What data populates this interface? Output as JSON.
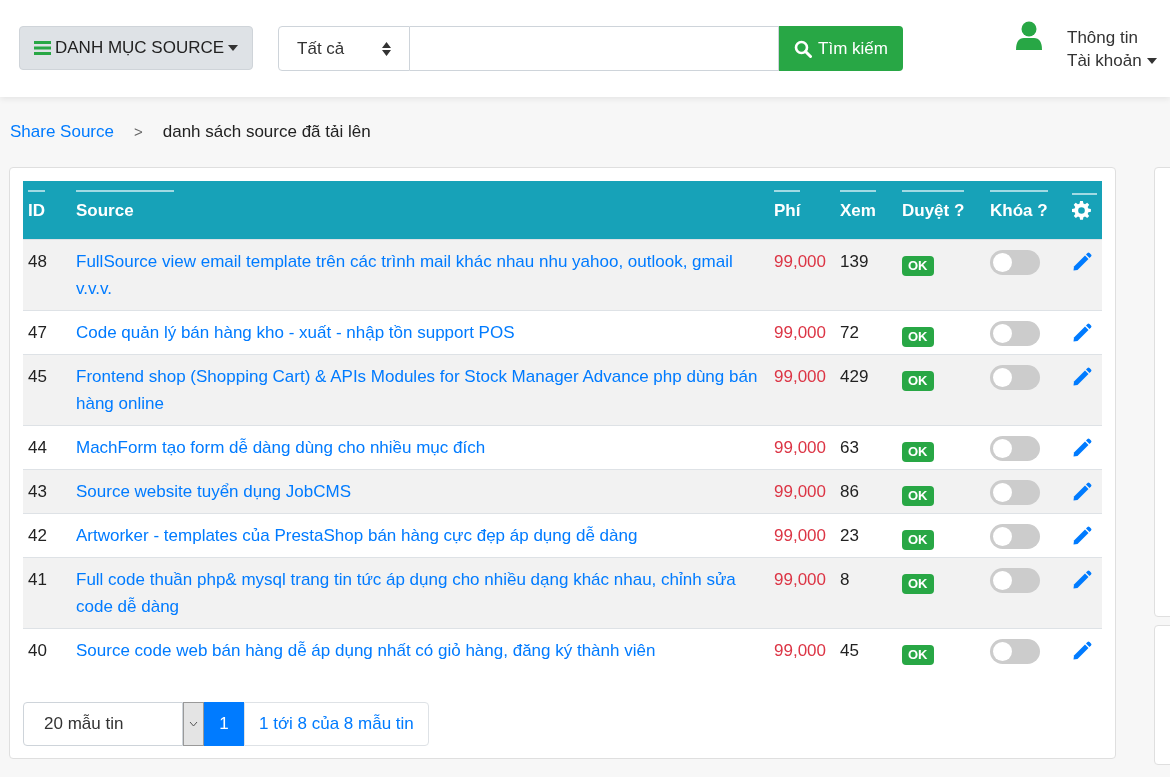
{
  "header": {
    "menu_button": "DANH MỤC SOURCE",
    "filter_select": "Tất cả",
    "search_button": "Tìm kiếm",
    "account": [
      "Thông tin",
      "Tài khoản"
    ]
  },
  "breadcrumb": {
    "link": "Share Source",
    "separator": ">",
    "current": "danh sách source đã tải lên"
  },
  "table": {
    "columns": [
      "ID",
      "Source",
      "Phí",
      "Xem",
      "Duyệt ?",
      "Khóa ?"
    ],
    "rows": [
      {
        "id": "48",
        "source": "FullSource view email template trên các trình mail khác nhau nhu yahoo, outlook, gmail v.v.v.",
        "fee": "99,000",
        "views": "139",
        "approved": true,
        "status": "OK",
        "locked": false
      },
      {
        "id": "47",
        "source": "Code quản lý bán hàng kho - xuất - nhập tồn support POS",
        "fee": "99,000",
        "views": "72",
        "approved": true,
        "status": "OK",
        "locked": false
      },
      {
        "id": "45",
        "source": "Frontend shop (Shopping Cart) & APIs Modules for Stock Manager Advance php dùng bán hàng online",
        "fee": "99,000",
        "views": "429",
        "approved": true,
        "status": "OK",
        "locked": false
      },
      {
        "id": "44",
        "source": "MachForm tạo form dễ dàng dùng cho nhiều mục đích",
        "fee": "99,000",
        "views": "63",
        "approved": true,
        "status": "OK",
        "locked": false
      },
      {
        "id": "43",
        "source": "Source website tuyển dụng JobCMS",
        "fee": "99,000",
        "views": "86",
        "approved": true,
        "status": "OK",
        "locked": false
      },
      {
        "id": "42",
        "source": "Artworker - templates của PrestaShop bán hàng cực đẹp áp dụng dễ dàng",
        "fee": "99,000",
        "views": "23",
        "approved": true,
        "status": "OK",
        "locked": false
      },
      {
        "id": "41",
        "source": "Full code thuần php& mysql trang tin tức áp dụng cho nhiều dạng khác nhau, chỉnh sửa code dễ dàng",
        "fee": "99,000",
        "views": "8",
        "approved": true,
        "status": "OK",
        "locked": false
      },
      {
        "id": "40",
        "source": "Source code web bán hàng dễ áp dụng nhất có giỏ hàng, đăng ký thành viên",
        "fee": "99,000",
        "views": "45",
        "approved": true,
        "status": "OK",
        "locked": false
      }
    ]
  },
  "pagination": {
    "page_size": "20 mẫu tin",
    "pages": [
      {
        "label": "1",
        "selected": true
      }
    ],
    "summary": "1 tới 8 của 8 mẫu tin"
  }
}
